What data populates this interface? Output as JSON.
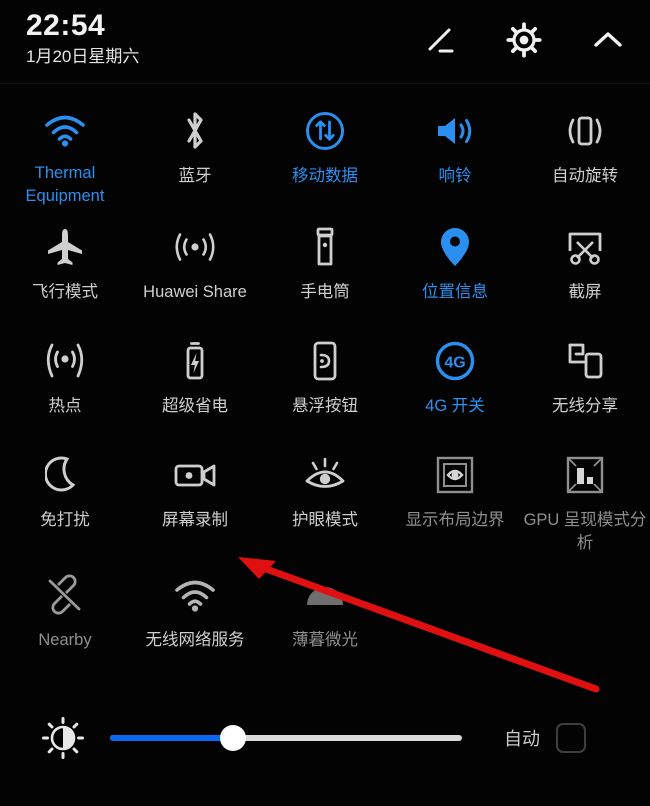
{
  "header": {
    "time": "22:54",
    "date": "1月20日星期六",
    "actions": [
      {
        "name": "edit-icon",
        "label": "编辑"
      },
      {
        "name": "gear-icon",
        "label": "设置"
      },
      {
        "name": "chevron-up-icon",
        "label": "收起"
      }
    ]
  },
  "colors": {
    "active": "#2b8ff0",
    "inactive": "#cfcfcf",
    "disabled": "#8f8f8f",
    "background": "#030303",
    "slider_fill": "#0a68f0",
    "annotation": "#e01010"
  },
  "tiles": [
    [
      {
        "label": "Thermal Equipment",
        "icon": "wifi-icon",
        "state": "active"
      },
      {
        "label": "蓝牙",
        "icon": "bluetooth-icon",
        "state": "inactive"
      },
      {
        "label": "移动数据",
        "icon": "mobile-data-icon",
        "state": "active"
      },
      {
        "label": "响铃",
        "icon": "ringer-icon",
        "state": "active"
      },
      {
        "label": "自动旋转",
        "icon": "auto-rotate-icon",
        "state": "inactive"
      }
    ],
    [
      {
        "label": "飞行模式",
        "icon": "airplane-icon",
        "state": "inactive"
      },
      {
        "label": "Huawei Share",
        "icon": "huawei-share-icon",
        "state": "inactive"
      },
      {
        "label": "手电筒",
        "icon": "flashlight-icon",
        "state": "inactive"
      },
      {
        "label": "位置信息",
        "icon": "location-pin-icon",
        "state": "active"
      },
      {
        "label": "截屏",
        "icon": "screenshot-icon",
        "state": "inactive"
      }
    ],
    [
      {
        "label": "热点",
        "icon": "hotspot-icon",
        "state": "inactive"
      },
      {
        "label": "超级省电",
        "icon": "battery-saver-icon",
        "state": "inactive"
      },
      {
        "label": "悬浮按钮",
        "icon": "floating-button-icon",
        "state": "inactive"
      },
      {
        "label": "4G 开关",
        "icon": "four-g-icon",
        "state": "active"
      },
      {
        "label": "无线分享",
        "icon": "wireless-share-icon",
        "state": "inactive"
      }
    ],
    [
      {
        "label": "免打扰",
        "icon": "moon-icon",
        "state": "inactive"
      },
      {
        "label": "屏幕录制",
        "icon": "screen-record-icon",
        "state": "inactive"
      },
      {
        "label": "护眼模式",
        "icon": "eye-comfort-icon",
        "state": "inactive"
      },
      {
        "label": "显示布局边界",
        "icon": "layout-bounds-icon",
        "state": "inactive"
      },
      {
        "label": "GPU 呈现模式分析",
        "icon": "gpu-rendering-icon",
        "state": "inactive"
      }
    ],
    [
      {
        "label": "Nearby",
        "icon": "nearby-off-icon",
        "state": "inactive"
      },
      {
        "label": "无线网络服务",
        "icon": "wireless-service-icon",
        "state": "inactive"
      },
      {
        "label": "薄暮微光",
        "icon": "twilight-icon",
        "state": "disabled"
      }
    ]
  ],
  "brightness": {
    "icon": "brightness-sun-icon",
    "value_percent": 35,
    "auto_label": "自动",
    "auto_checked": false
  },
  "annotation": {
    "type": "arrow",
    "points_to": "屏幕录制",
    "color": "#e01010"
  }
}
